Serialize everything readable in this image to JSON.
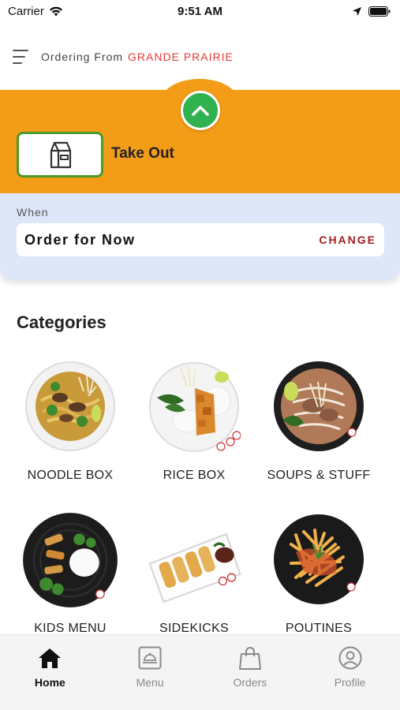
{
  "status_bar": {
    "carrier": "Carrier",
    "time": "9:51 AM"
  },
  "header": {
    "ordering_from": "Ordering From",
    "location": "GRANDE PRAIRIE"
  },
  "order_type": {
    "label": "Take Out"
  },
  "when": {
    "label": "When",
    "value": "Order for Now",
    "change_label": "CHANGE"
  },
  "categories": {
    "title": "Categories",
    "items": [
      {
        "name": "NOODLE BOX"
      },
      {
        "name": "RICE BOX"
      },
      {
        "name": "SOUPS & STUFF"
      },
      {
        "name": "KIDS MENU"
      },
      {
        "name": "SIDEKICKS"
      },
      {
        "name": "POUTINES"
      }
    ]
  },
  "tabs": [
    {
      "label": "Home",
      "icon": "home-icon",
      "active": true
    },
    {
      "label": "Menu",
      "icon": "menu-tray-icon",
      "active": false
    },
    {
      "label": "Orders",
      "icon": "bag-icon",
      "active": false
    },
    {
      "label": "Profile",
      "icon": "profile-icon",
      "active": false
    }
  ],
  "colors": {
    "accent_orange": "#f39c17",
    "accent_green": "#2fb24f",
    "location_red": "#e53935",
    "change_red": "#a31e22",
    "when_bg": "#dde7f8"
  }
}
